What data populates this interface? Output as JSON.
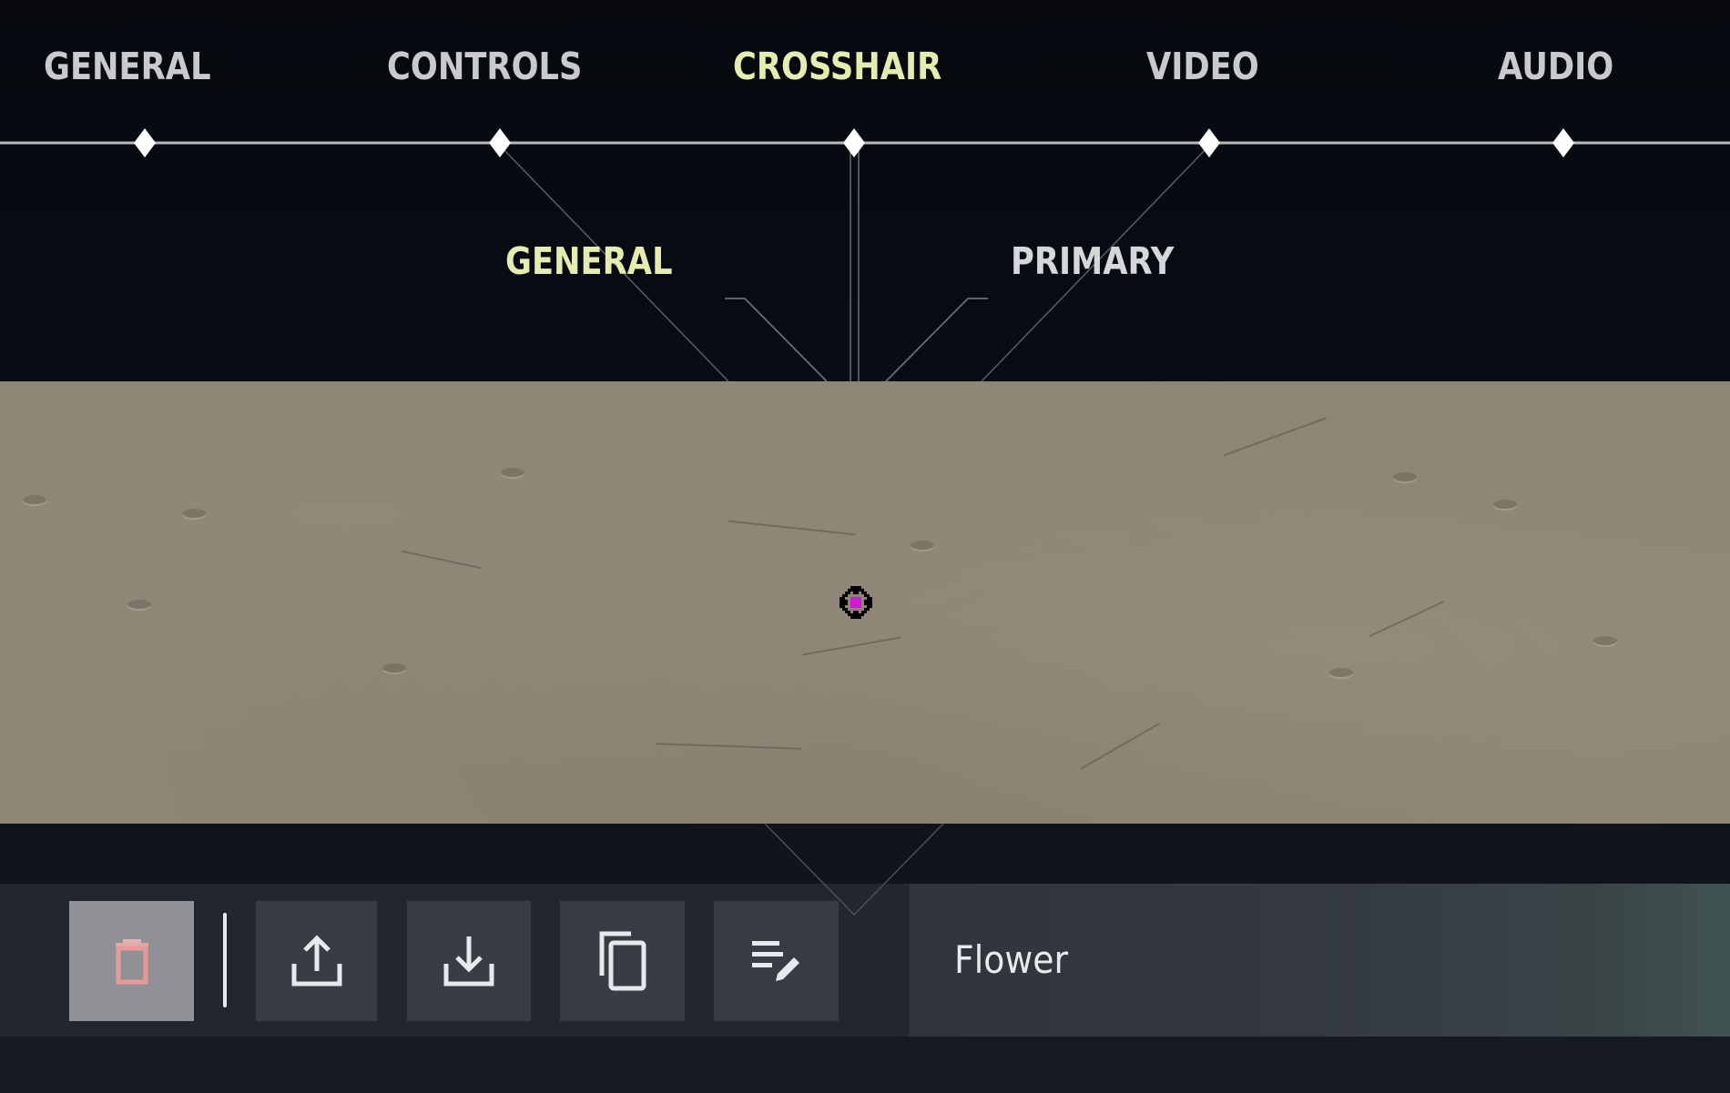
{
  "top_nav": {
    "tabs": [
      {
        "label": "GENERAL",
        "active": false
      },
      {
        "label": "CONTROLS",
        "active": false
      },
      {
        "label": "CROSSHAIR",
        "active": true
      },
      {
        "label": "VIDEO",
        "active": false
      },
      {
        "label": "AUDIO",
        "active": false
      }
    ]
  },
  "sub_nav": {
    "tabs": [
      {
        "label": "GENERAL",
        "active": true
      },
      {
        "label": "PRIMARY",
        "active": false
      }
    ]
  },
  "crosshair_preview": {
    "icon": "crosshair-preview-icon",
    "center_color": "#d417d4",
    "outline_color": "#000000"
  },
  "toolbar": {
    "buttons": [
      {
        "name": "delete-profile-button",
        "icon": "trash-icon",
        "selected": true
      },
      {
        "name": "import-profile-button",
        "icon": "upload-icon",
        "selected": false
      },
      {
        "name": "export-profile-button",
        "icon": "download-icon",
        "selected": false
      },
      {
        "name": "duplicate-profile-button",
        "icon": "copy-icon",
        "selected": false
      },
      {
        "name": "rename-profile-button",
        "icon": "edit-list-icon",
        "selected": false
      }
    ]
  },
  "profile": {
    "name": "Flower"
  },
  "colors": {
    "active_tab": "#e6ebb0",
    "inactive_tab": "#c9cacd",
    "delete_icon": "#e08a8a"
  }
}
